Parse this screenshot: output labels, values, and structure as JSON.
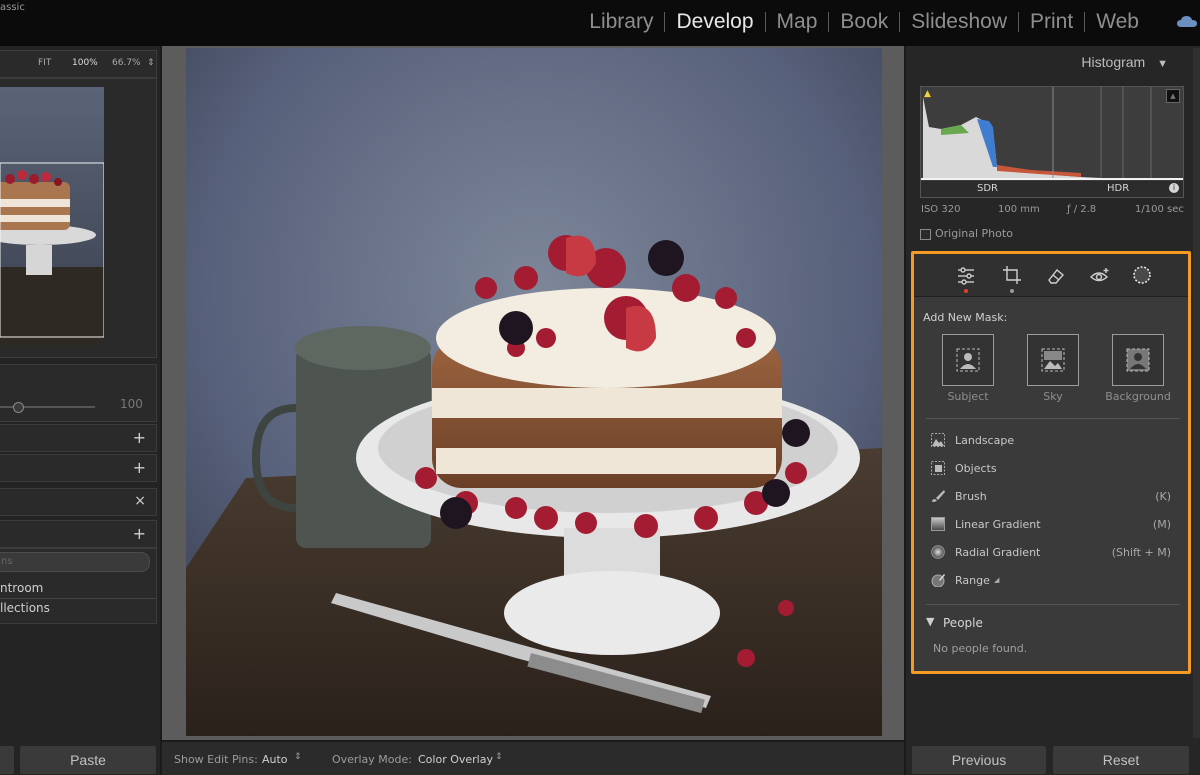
{
  "app": {
    "title_fragment": "assic"
  },
  "modules": [
    {
      "label": "Library",
      "active": false
    },
    {
      "label": "Develop",
      "active": true
    },
    {
      "label": "Map",
      "active": false
    },
    {
      "label": "Book",
      "active": false
    },
    {
      "label": "Slideshow",
      "active": false
    },
    {
      "label": "Print",
      "active": false
    },
    {
      "label": "Web",
      "active": false
    }
  ],
  "navigator": {
    "fit": "FIT",
    "zoom1": "100%",
    "zoom2": "66.7%"
  },
  "left_panel": {
    "slider_value": "100",
    "search_placeholder": "ns",
    "collection_items": [
      "ntroom",
      "llections"
    ],
    "copy_label": "",
    "paste_label": "Paste"
  },
  "center_toolbar": {
    "show_edit_pins_label": "Show Edit Pins:",
    "show_edit_pins_value": "Auto",
    "overlay_mode_label": "Overlay Mode:",
    "overlay_mode_value": "Color Overlay"
  },
  "histogram": {
    "title": "Histogram",
    "sdr": "SDR",
    "hdr": "HDR",
    "iso": "ISO 320",
    "focal": "100 mm",
    "aperture": "ƒ / 2.8",
    "shutter": "1/100 sec",
    "original_photo_label": "Original Photo"
  },
  "masking": {
    "add_new_mask": "Add New Mask:",
    "big_buttons": [
      {
        "label": "Subject",
        "icon": "subject-icon"
      },
      {
        "label": "Sky",
        "icon": "sky-icon"
      },
      {
        "label": "Background",
        "icon": "background-icon"
      }
    ],
    "tools": [
      {
        "label": "Landscape",
        "shortcut": "",
        "icon": "landscape-icon"
      },
      {
        "label": "Objects",
        "shortcut": "",
        "icon": "objects-icon"
      },
      {
        "label": "Brush",
        "shortcut": "(K)",
        "icon": "brush-icon"
      },
      {
        "label": "Linear Gradient",
        "shortcut": "(M)",
        "icon": "linear-gradient-icon"
      },
      {
        "label": "Radial Gradient",
        "shortcut": "(Shift + M)",
        "icon": "radial-gradient-icon"
      },
      {
        "label": "Range",
        "shortcut": "",
        "icon": "range-icon"
      }
    ],
    "people_title": "People",
    "people_empty": "No people found."
  },
  "bottom_right": {
    "previous": "Previous",
    "reset": "Reset"
  },
  "colors": {
    "accent": "#f59a23",
    "active_module": "#e8e8e8"
  }
}
